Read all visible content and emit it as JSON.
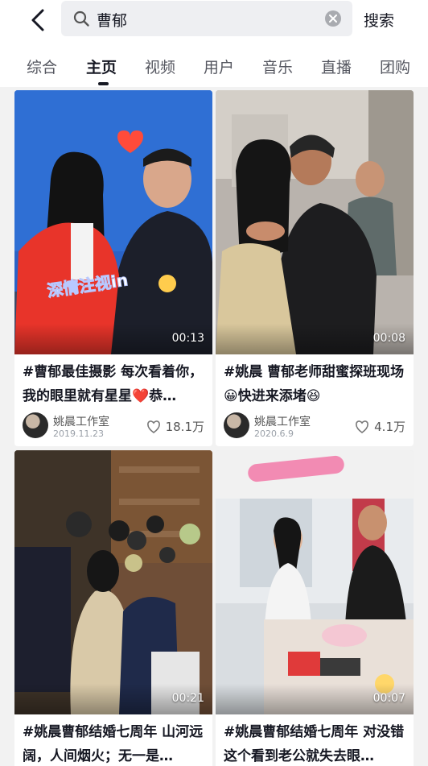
{
  "search": {
    "query": "曹郁",
    "button_label": "搜索"
  },
  "tabs": [
    "综合",
    "主页",
    "视频",
    "用户",
    "音乐",
    "直播",
    "团购"
  ],
  "active_tab_index": 1,
  "cards": [
    {
      "duration": "00:13",
      "overlay_text": "深情注视in",
      "title": "#曹郁最佳摄影 每次看着你，我的眼里就有星星❤️恭…",
      "author": "姚晨工作室",
      "date": "2019.11.23",
      "likes": "18.1万"
    },
    {
      "duration": "00:08",
      "title": "#姚晨 曹郁老师甜蜜探班现场😀快进来添堵😆",
      "author": "姚晨工作室",
      "date": "2020.6.9",
      "likes": "4.1万"
    },
    {
      "duration": "00:21",
      "title": "#姚晨曹郁结婚七周年 山河远阔，人间烟火；无一是…"
    },
    {
      "duration": "00:07",
      "title": "#姚晨曹郁结婚七周年 对没错这个看到老公就失去眼…"
    }
  ],
  "colors": {
    "accent": "#161823",
    "heart_red": "#ff4b3a"
  }
}
